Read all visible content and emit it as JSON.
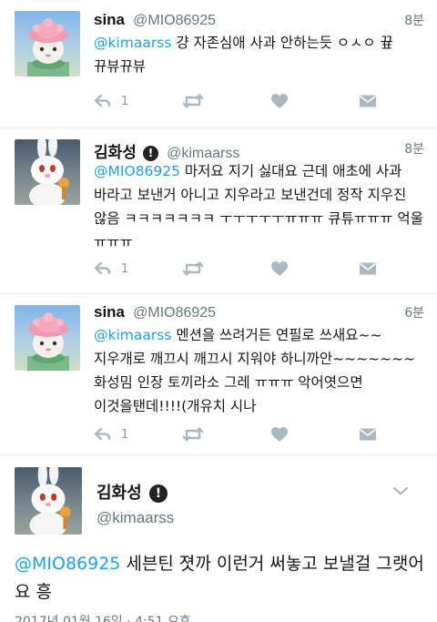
{
  "tweets": [
    {
      "name": "sina",
      "handle": "@MIO86925",
      "time": "8분",
      "mention": "@kimaarss",
      "text": " 걍 자존심애 사과 안하는듯 ㅇㅅㅇ 끂 뀨뷰뀨뷰",
      "reply_count": "1",
      "avatar_icon": "pink-hat-character-avatar"
    },
    {
      "name": "김화성",
      "handle": "@kimaarss",
      "time": "8분",
      "mention": "@MIO86925",
      "text": " 마저요 지기 싫대요 근데 애초에 사과 바라고 보낸거 아니고 지우라고 보낸건데 정작 지우진 않음 ㅋㅋㅋㅋㅋㅋㅋ ㅜㅜㅜㅜㅜㅠㅠㅠ 큐튜ㅠㅠㅠ 억울 ㅠㅠㅠ",
      "reply_count": "1",
      "avatar_icon": "white-rabbit-avatar"
    },
    {
      "name": "sina",
      "handle": "@MIO86925",
      "time": "6분",
      "mention": "@kimaarss",
      "text": " 멘션을 쓰려거든 연필로 쓰새요~~ 지우개로 깨끄시 깨끄시 지워야 하니까안~~~~~~~  화성밈 인장 토끼라소 그레 ㅠㅠㅠ 악어엿으면 이것을탠데!!!!(개유치 시나",
      "reply_count": "1",
      "avatar_icon": "pink-hat-character-avatar"
    }
  ],
  "expanded": {
    "name": "김화성",
    "handle": "@kimaarss",
    "mention": "@MIO86925",
    "text": " 세븐틴 졋까 이런거 써놓고 보낼걸 그랫어요 흥",
    "meta": "2017년 01월 16일 · 4:51 오후"
  },
  "colors": {
    "link": "#1da1f2",
    "text": "#14171a",
    "secondary": "#657786",
    "icon": "#aab8c2",
    "divider": "#e6ecf0"
  },
  "icons": [
    "reply-icon",
    "retweet-icon",
    "like-icon",
    "direct-message-icon",
    "chevron-down-icon",
    "protected-badge-icon"
  ]
}
